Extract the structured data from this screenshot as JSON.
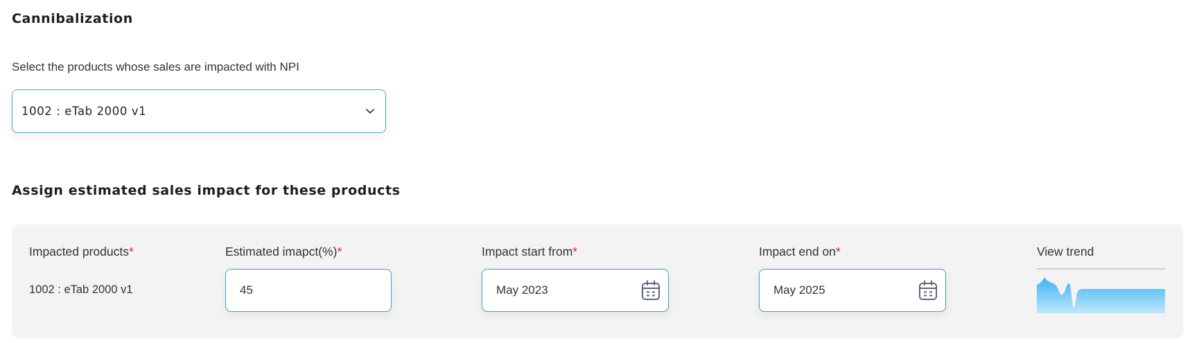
{
  "section1": {
    "title": "Cannibalization"
  },
  "select_prompt": "Select the products whose sales are impacted with NPI",
  "product_select": {
    "value": "1002 : eTab 2000 v1",
    "icon": "chevron-down-icon"
  },
  "section2": {
    "title": "Assign estimated sales impact for these products"
  },
  "columns": {
    "impacted_products": "Impacted products",
    "estimated_impact": "Estimated imapct(%)",
    "impact_start": "Impact start from",
    "impact_end": "Impact end on",
    "view_trend": "View trend",
    "required_marker": "*"
  },
  "row": {
    "product": "1002 : eTab 2000 v1",
    "impact_percent": "45",
    "start": "May 2023",
    "end": "May 2025"
  },
  "icons": {
    "calendar": "calendar-icon"
  },
  "colors": {
    "accent_border": "#4aa8c4",
    "required": "#e0242e",
    "panel_bg": "#f3f3f3",
    "trend_fill": "#48b9f0"
  }
}
